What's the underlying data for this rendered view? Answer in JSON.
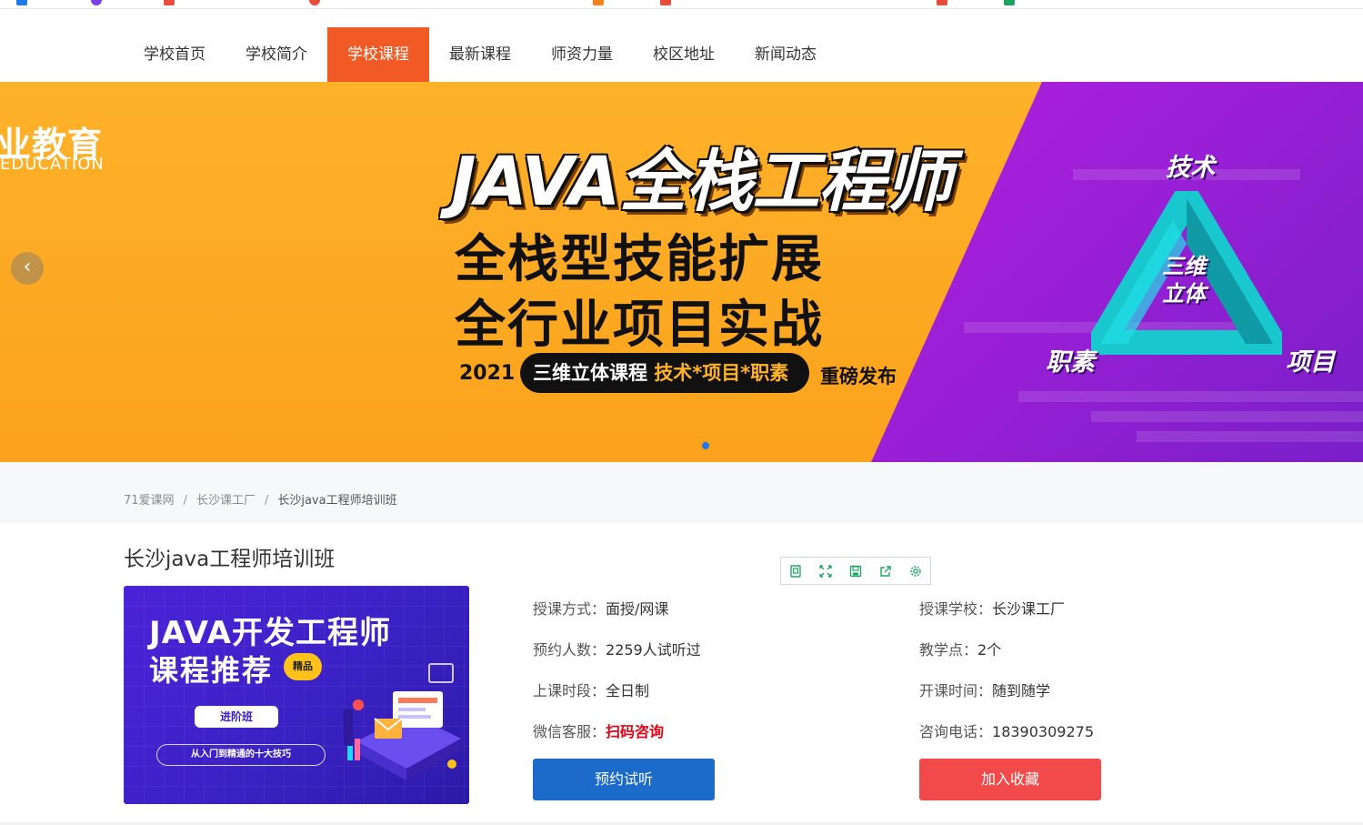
{
  "nav": {
    "items": [
      "学校首页",
      "学校简介",
      "学校课程",
      "最新课程",
      "师资力量",
      "校区地址",
      "新闻动态"
    ],
    "active_index": 2
  },
  "banner": {
    "brand_cn": "业教育",
    "brand_en": "EDUCATION",
    "title": "JAVA全栈工程师",
    "line1": "全栈型技能扩展",
    "line2": "全行业项目实战",
    "year": "2021",
    "pill_text": "三维立体课程 ",
    "pill_highlight": "技术*项目*职素",
    "release": "重磅发布",
    "kw_tech": "技术",
    "kw_soft": "职素",
    "kw_proj": "项目",
    "tri_line1": "三维",
    "tri_line2": "立体",
    "prev_arrow": "‹",
    "colors": {
      "orange": "#fdb22a",
      "purple": "#a21fdc",
      "cyan": "#19c7cf"
    }
  },
  "breadcrumb": {
    "items": [
      "71爱课网",
      "长沙课工厂",
      "长沙java工程师培训班"
    ],
    "separator": "/"
  },
  "course": {
    "title": "长沙java工程师培训班",
    "thumb": {
      "title": "JAVA开发工程师",
      "subtitle": "课程推荐",
      "badge": "精品",
      "pill": "进阶班",
      "skills": "从入门到精通的十大技巧"
    },
    "left": [
      {
        "key": "授课方式：",
        "value": "面授/网课"
      },
      {
        "key": "预约人数：",
        "value": "2259人试听过"
      },
      {
        "key": "上课时段：",
        "value": "全日制"
      },
      {
        "key": "微信客服：",
        "value": "扫码咨询"
      }
    ],
    "right": [
      {
        "key": "授课学校：",
        "value": "长沙课工厂"
      },
      {
        "key": "教学点：",
        "value": "2个"
      },
      {
        "key": "开课时间：",
        "value": "随到随学"
      },
      {
        "key": "咨询电话：",
        "value": "18390309275"
      }
    ],
    "book_button": "预约试听",
    "fav_button": "加入收藏"
  },
  "toolbar": {
    "icons": [
      "copy-icon",
      "fullscreen-icon",
      "save-icon",
      "share-icon",
      "settings-icon"
    ],
    "color": "#22a866"
  }
}
